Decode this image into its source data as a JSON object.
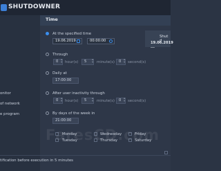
{
  "app": {
    "title": "SHUTDOWNER"
  },
  "header": {
    "time_label": "Time"
  },
  "left_labels": {
    "monitor": "onitor",
    "network": "of network",
    "program": "e program",
    "notification": "tification before execution in 5 minutes"
  },
  "options": {
    "at_time": {
      "label": "At the specified time",
      "date": "19.06.2019",
      "time": "00:00:00"
    },
    "through": {
      "label": "Through",
      "hours_value": "0",
      "hours_unit": "hour(s)",
      "minutes_value": "5",
      "minutes_unit": "minute(s)",
      "seconds_value": "0",
      "seconds_unit": "second(s)"
    },
    "daily": {
      "label": "Daily at",
      "time": "17:00:00"
    },
    "inactivity": {
      "label": "After user inactivity through",
      "hours_value": "0",
      "hours_unit": "hour(s)",
      "minutes_value": "5",
      "minutes_unit": "minute(s)",
      "seconds_value": "0",
      "seconds_unit": "second(s)"
    },
    "weekdays": {
      "label": "By days of the week in",
      "time": "21:00:00",
      "days": [
        "Monday",
        "Wednesday",
        "Friday",
        "Tuesday",
        "Thursday",
        "Saturday"
      ]
    }
  },
  "shutdown_panel": {
    "label": "Shut d",
    "date": "19.06.2019 ..."
  },
  "watermark": "FaresCD.com"
}
